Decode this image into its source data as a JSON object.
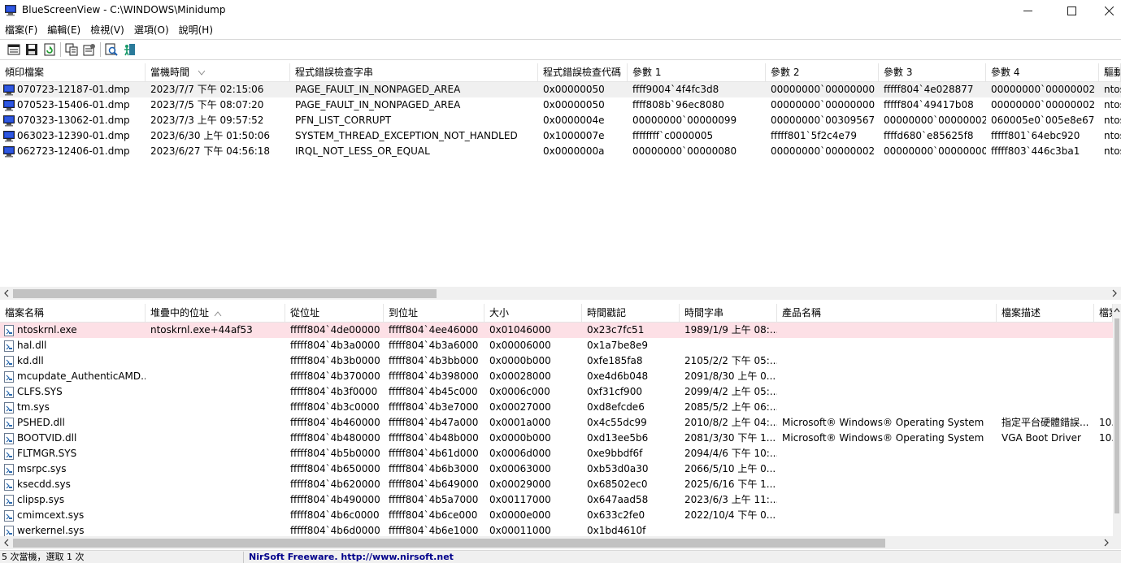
{
  "window": {
    "title": "BlueScreenView  -  C:\\WINDOWS\\Minidump",
    "minimize_icon": "minimize-icon",
    "maximize_icon": "maximize-icon",
    "close_icon": "close-icon"
  },
  "menu": [
    {
      "label": "檔案(F)"
    },
    {
      "label": "編輯(E)"
    },
    {
      "label": "檢視(V)"
    },
    {
      "label": "選項(O)"
    },
    {
      "label": "說明(H)"
    }
  ],
  "toolbar": [
    {
      "icon": "html-report-icon"
    },
    {
      "icon": "save-icon"
    },
    {
      "icon": "refresh-icon"
    },
    {
      "icon": "copy-icon"
    },
    {
      "icon": "properties-icon"
    },
    {
      "icon": "find-icon"
    },
    {
      "icon": "exit-icon"
    }
  ],
  "upper": {
    "columns": [
      "傾印檔案",
      "當機時間",
      "程式錯誤檢查字串",
      "程式錯誤檢查代碼",
      "參數 1",
      "參數 2",
      "參數 3",
      "參數 4",
      "驅動"
    ],
    "rows": [
      [
        "070723-12187-01.dmp",
        "2023/7/7 下午 02:15:06",
        "PAGE_FAULT_IN_NONPAGED_AREA",
        "0x00000050",
        "ffff9004`4f4fc3d8",
        "00000000`00000000",
        "fffff804`4e028877",
        "00000000`00000002",
        "ntos"
      ],
      [
        "070523-15406-01.dmp",
        "2023/7/5 下午 08:07:20",
        "PAGE_FAULT_IN_NONPAGED_AREA",
        "0x00000050",
        "ffff808b`96ec8080",
        "00000000`00000000",
        "fffff804`49417b08",
        "00000000`00000002",
        "ntos"
      ],
      [
        "070323-13062-01.dmp",
        "2023/7/3 上午 09:57:52",
        "PFN_LIST_CORRUPT",
        "0x0000004e",
        "00000000`00000099",
        "00000000`00309567",
        "00000000`00000002",
        "060005e0`005e8e67",
        "ntos"
      ],
      [
        "063023-12390-01.dmp",
        "2023/6/30 上午 01:50:06",
        "SYSTEM_THREAD_EXCEPTION_NOT_HANDLED",
        "0x1000007e",
        "ffffffff`c0000005",
        "fffff801`5f2c4e79",
        "ffffd680`e85625f8",
        "fffff801`64ebc920",
        "ntos"
      ],
      [
        "062723-12406-01.dmp",
        "2023/6/27 下午 04:56:18",
        "IRQL_NOT_LESS_OR_EQUAL",
        "0x0000000a",
        "00000000`00000080",
        "00000000`00000002",
        "00000000`00000000",
        "fffff803`446c3ba1",
        "ntos"
      ]
    ]
  },
  "lower": {
    "columns": [
      "檔案名稱",
      "堆疊中的位址",
      "從位址",
      "到位址",
      "大小",
      "時間戳記",
      "時間字串",
      "產品名稱",
      "檔案描述",
      "檔案"
    ],
    "rows": [
      [
        "ntoskrnl.exe",
        "ntoskrnl.exe+44af53",
        "fffff804`4de00000",
        "fffff804`4ee46000",
        "0x01046000",
        "0x23c7fc51",
        "1989/1/9 上午 08:...",
        "",
        "",
        ""
      ],
      [
        "hal.dll",
        "",
        "fffff804`4b3a0000",
        "fffff804`4b3a6000",
        "0x00006000",
        "0x1a7be8e9",
        "",
        "",
        "",
        ""
      ],
      [
        "kd.dll",
        "",
        "fffff804`4b3b0000",
        "fffff804`4b3bb000",
        "0x0000b000",
        "0xfe185fa8",
        "2105/2/2 下午 05:...",
        "",
        "",
        ""
      ],
      [
        "mcupdate_AuthenticAMD...",
        "",
        "fffff804`4b370000",
        "fffff804`4b398000",
        "0x00028000",
        "0xe4d6b048",
        "2091/8/30 上午 0...",
        "",
        "",
        ""
      ],
      [
        "CLFS.SYS",
        "",
        "fffff804`4b3f0000",
        "fffff804`4b45c000",
        "0x0006c000",
        "0xf31cf900",
        "2099/4/2 上午 05:...",
        "",
        "",
        ""
      ],
      [
        "tm.sys",
        "",
        "fffff804`4b3c0000",
        "fffff804`4b3e7000",
        "0x00027000",
        "0xd8efcde6",
        "2085/5/2 上午 06:...",
        "",
        "",
        ""
      ],
      [
        "PSHED.dll",
        "",
        "fffff804`4b460000",
        "fffff804`4b47a000",
        "0x0001a000",
        "0x4c55dc99",
        "2010/8/2 上午 04:...",
        "Microsoft® Windows® Operating System",
        "指定平台硬體錯誤...",
        "10."
      ],
      [
        "BOOTVID.dll",
        "",
        "fffff804`4b480000",
        "fffff804`4b48b000",
        "0x0000b000",
        "0xd13ee5b6",
        "2081/3/30 下午 1...",
        "Microsoft® Windows® Operating System",
        "VGA Boot Driver",
        "10."
      ],
      [
        "FLTMGR.SYS",
        "",
        "fffff804`4b5b0000",
        "fffff804`4b61d000",
        "0x0006d000",
        "0xe9bbdf6f",
        "2094/4/6 下午 10:...",
        "",
        "",
        ""
      ],
      [
        "msrpc.sys",
        "",
        "fffff804`4b650000",
        "fffff804`4b6b3000",
        "0x00063000",
        "0xb53d0a30",
        "2066/5/10 上午 0...",
        "",
        "",
        ""
      ],
      [
        "ksecdd.sys",
        "",
        "fffff804`4b620000",
        "fffff804`4b649000",
        "0x00029000",
        "0x68502ec0",
        "2025/6/16 下午 1...",
        "",
        "",
        ""
      ],
      [
        "clipsp.sys",
        "",
        "fffff804`4b490000",
        "fffff804`4b5a7000",
        "0x00117000",
        "0x647aad58",
        "2023/6/3 上午 11:...",
        "",
        "",
        ""
      ],
      [
        "cmimcext.sys",
        "",
        "fffff804`4b6c0000",
        "fffff804`4b6ce000",
        "0x0000e000",
        "0x633c2fe0",
        "2022/10/4 下午 0...",
        "",
        "",
        ""
      ],
      [
        "werkernel.sys",
        "",
        "fffff804`4b6d0000",
        "fffff804`4b6e1000",
        "0x00011000",
        "0x1bd4610f",
        "",
        "",
        "",
        ""
      ]
    ]
  },
  "status": {
    "left": "5 次當機，選取 1 次",
    "link": "NirSoft Freeware.  http://www.nirsoft.net"
  },
  "colors": {
    "selected_pink": "#fde0e6",
    "selected_gray": "#f0f0f0",
    "link": "#00008b"
  }
}
